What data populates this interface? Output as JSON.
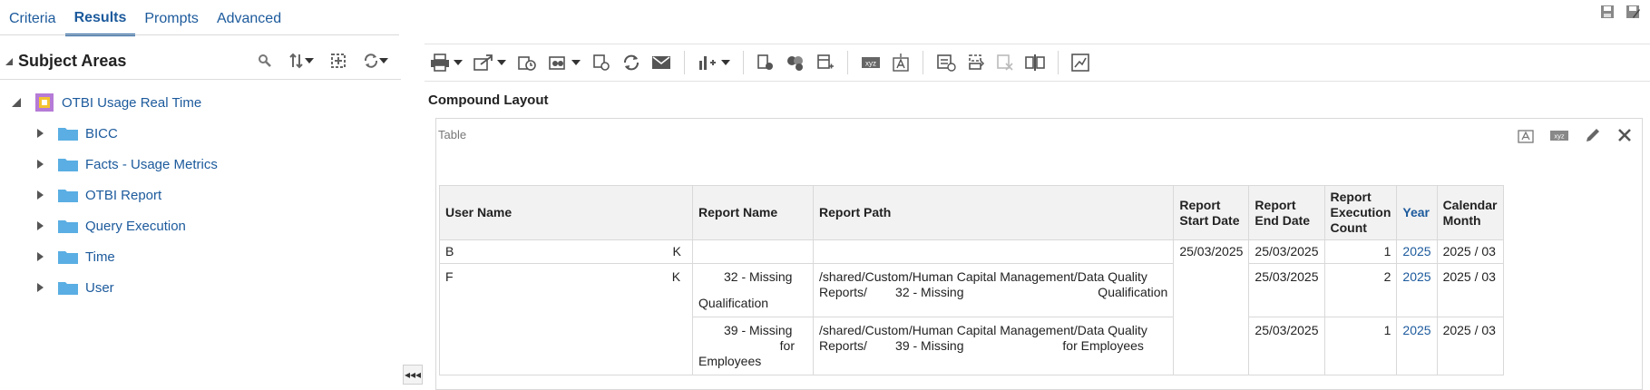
{
  "tabs": [
    {
      "label": "Criteria",
      "active": false
    },
    {
      "label": "Results",
      "active": true
    },
    {
      "label": "Prompts",
      "active": false
    },
    {
      "label": "Advanced",
      "active": false
    }
  ],
  "subject_areas": {
    "title": "Subject Areas",
    "root": "OTBI Usage Real Time",
    "folders": [
      "BICC",
      "Facts - Usage Metrics",
      "OTBI Report",
      "Query Execution",
      "Time",
      "User"
    ]
  },
  "layout": {
    "title": "Compound Layout",
    "view_label": "Table"
  },
  "table": {
    "headers": [
      "User Name",
      "Report Name",
      "Report Path",
      "Report Start Date",
      "Report End Date",
      "Report Execution Count",
      "Year",
      "Calendar Month"
    ],
    "rows": [
      {
        "user": "B                                                              K",
        "report_name_1": "",
        "report_name_2": "",
        "path_1": "",
        "path_2": "",
        "start": "25/03/2025",
        "end": "25/03/2025",
        "count": "1",
        "year": "2025",
        "month": "2025 / 03"
      },
      {
        "user": "F                                                              K",
        "report_name_1": "32 - Missing",
        "report_name_2": "Qualification",
        "path_1": "/shared/Custom/Human Capital Management/Data Quality",
        "path_2": "Reports/        32 - Missing                                      Qualification",
        "start": "",
        "end": "25/03/2025",
        "count": "2",
        "year": "2025",
        "month": "2025 / 03"
      },
      {
        "user": "",
        "report_name_1": "39 - Missing",
        "report_name_2": "for",
        "report_name_3": "Employees",
        "path_1": "/shared/Custom/Human Capital Management/Data Quality",
        "path_2": "Reports/        39 - Missing                            for Employees",
        "start": "",
        "end": "25/03/2025",
        "count": "1",
        "year": "2025",
        "month": "2025 / 03"
      }
    ]
  },
  "collapse_glyph": "◂◂◂"
}
